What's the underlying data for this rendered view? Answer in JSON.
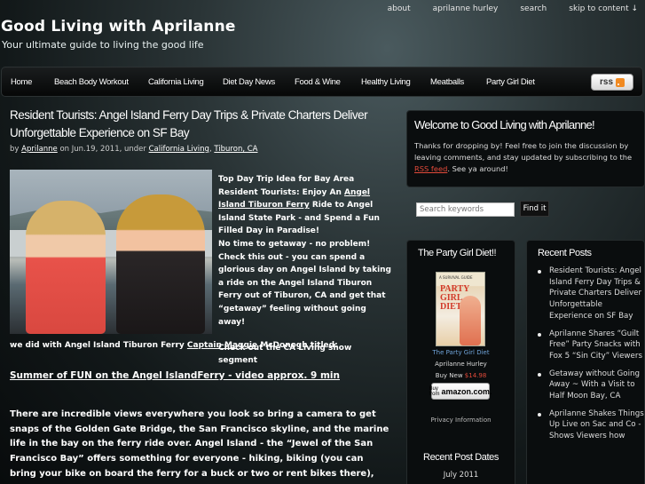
{
  "site": {
    "title": "Good Living with Aprilanne",
    "tagline": "Your ultimate guide to living the good life"
  },
  "top_links": [
    "about",
    "aprilanne hurley",
    "search",
    "skip to content ↓"
  ],
  "nav": [
    "Home",
    "Beach Body Workout",
    "California Living",
    "Diet Day News",
    "Food & Wine",
    "Healthy Living",
    "Meatballs",
    "Party Girl Diet"
  ],
  "rss_label": "rss",
  "post": {
    "title": "Resident Tourists: Angel Island Ferry Day Trips & Private Charters Deliver Unforgettable Experience on SF Bay",
    "byline": {
      "by": "by",
      "author": "Aprilanne",
      "on": " on Jun.19, 2011, under ",
      "cat1": "California Living",
      "sep": ", ",
      "cat2": "Tiburon, CA"
    },
    "intro": {
      "p1": "Top Day Trip Idea for Bay Area Resident Tourists:  Enjoy An ",
      "link1": "Angel Island Tiburon Ferry",
      "p2": " Ride to Angel Island State Park -  and Spend a Fun Filled Day  in Paradise!",
      "p3": "No time to getaway - no problem!  Check this out -  you can spend a glorious day on Angel Island by taking a ride on the Angel Island Tiburon Ferry out of Tiburon, CA and get that “getaway” feeling without going away!",
      "p4": "Check out the CA Living show segment"
    },
    "cont": {
      "p1": "we did with Angel Island Tiburon Ferry ",
      "link": "Captain Maggie",
      "p2": " McDonogh titled:"
    },
    "video_link": "Summer of FUN on the Angel IslandFerry - video approx. 9 min",
    "body": "There are incredible views everywhere you look so bring a camera to get snaps of the Golden Gate Bridge, the San Francisco skyline, and the marine life in the bay on the ferry ride over.  Angel Island - the “Jewel of the San Francisco Bay”  offers something for everyone - hiking, biking (you can bring your bike on board the ferry for a buck or two or rent bikes there), picnicking - and of course beautiful beaches!"
  },
  "welcome": {
    "title": "Welcome to Good Living with Aprilanne!",
    "text1": "Thanks for dropping by! Feel free to join the discussion by leaving comments, and stay updated by subscribing to the ",
    "rss_link": "RSS feed",
    "text2": ". See ya around!"
  },
  "search": {
    "placeholder": "Search keywords",
    "button": "Find it"
  },
  "party_widget": {
    "title": "The Party Girl Diet!!",
    "book_top": "A SURVIVAL GUIDE",
    "book_title": "PARTY GIRL DIET",
    "book_link": "The Party Girl Diet",
    "author": "Aprilanne Hurley",
    "buy_prefix": "Buy New ",
    "price": "$14.98",
    "buy_small": "Buy from",
    "buy_brand": "amazon.com.",
    "privacy": "Privacy Information",
    "dates_title": "Recent Post Dates",
    "date1": "July 2011"
  },
  "recent_widget": {
    "title": "Recent Posts",
    "items": [
      "Resident Tourists: Angel Island Ferry Day Trips & Private Charters Deliver Unforgettable Experience on SF Bay",
      "Aprilanne Shares “Guilt Free” Party Snacks with Fox 5 “Sin City” Viewers",
      "Getaway without Going Away ~ With a Visit to Half Moon Bay, CA",
      "Aprilanne Shakes Things Up Live on Sac and Co - Shows Viewers how"
    ]
  },
  "colors": {
    "accent_link": "#e34a3a",
    "price": "#e34a3a",
    "book_link": "#6fa3d8"
  }
}
